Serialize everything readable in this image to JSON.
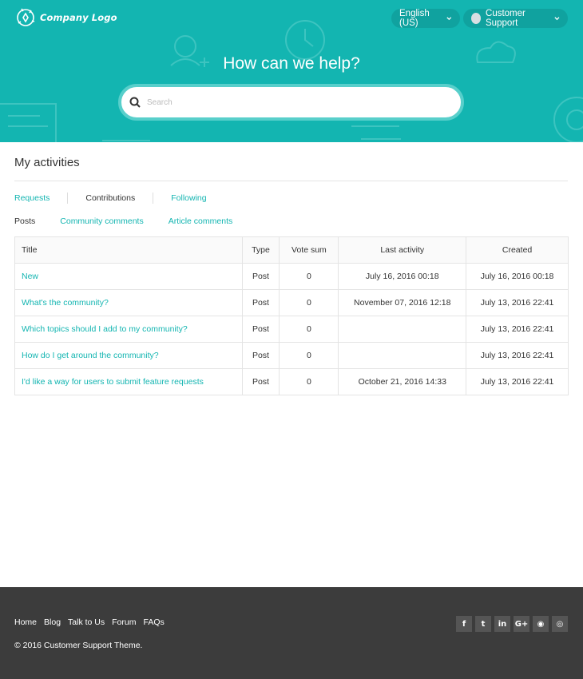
{
  "header": {
    "logo_text": "Company Logo",
    "language": "English (US)",
    "user_name": "Customer Support",
    "hero_title": "How can we help?",
    "search_placeholder": "Search",
    "accent_color": "#13b5b1"
  },
  "main": {
    "title": "My activities",
    "tabs": [
      {
        "label": "Requests"
      },
      {
        "label": "Contributions"
      },
      {
        "label": "Following"
      }
    ],
    "subtabs": [
      {
        "label": "Posts"
      },
      {
        "label": "Community comments"
      },
      {
        "label": "Article comments"
      }
    ],
    "table": {
      "headers": {
        "title": "Title",
        "type": "Type",
        "vote_sum": "Vote sum",
        "last_activity": "Last activity",
        "created": "Created"
      },
      "rows": [
        {
          "title": "New",
          "type": "Post",
          "vote_sum": "0",
          "last_activity": "July 16, 2016 00:18",
          "created": "July 16, 2016 00:18"
        },
        {
          "title": "What's the community?",
          "type": "Post",
          "vote_sum": "0",
          "last_activity": "November 07, 2016 12:18",
          "created": "July 13, 2016 22:41"
        },
        {
          "title": "Which topics should I add to my community?",
          "type": "Post",
          "vote_sum": "0",
          "last_activity": "",
          "created": "July 13, 2016 22:41"
        },
        {
          "title": "How do I get around the community?",
          "type": "Post",
          "vote_sum": "0",
          "last_activity": "",
          "created": "July 13, 2016 22:41"
        },
        {
          "title": "I'd like a way for users to submit feature requests",
          "type": "Post",
          "vote_sum": "0",
          "last_activity": "October 21, 2016 14:33",
          "created": "July 13, 2016 22:41"
        }
      ]
    }
  },
  "footer": {
    "links": [
      {
        "label": "Home"
      },
      {
        "label": "Blog"
      },
      {
        "label": "Talk to Us"
      },
      {
        "label": "Forum"
      },
      {
        "label": "FAQs"
      }
    ],
    "copyright": "© 2016 Customer Support Theme.",
    "social": [
      {
        "icon": "facebook-icon",
        "glyph": "f"
      },
      {
        "icon": "twitter-icon",
        "glyph": "t"
      },
      {
        "icon": "linkedin-icon",
        "glyph": "in"
      },
      {
        "icon": "google-plus-icon",
        "glyph": "G+"
      },
      {
        "icon": "github-icon",
        "glyph": "◉"
      },
      {
        "icon": "instagram-icon",
        "glyph": "◎"
      }
    ]
  }
}
